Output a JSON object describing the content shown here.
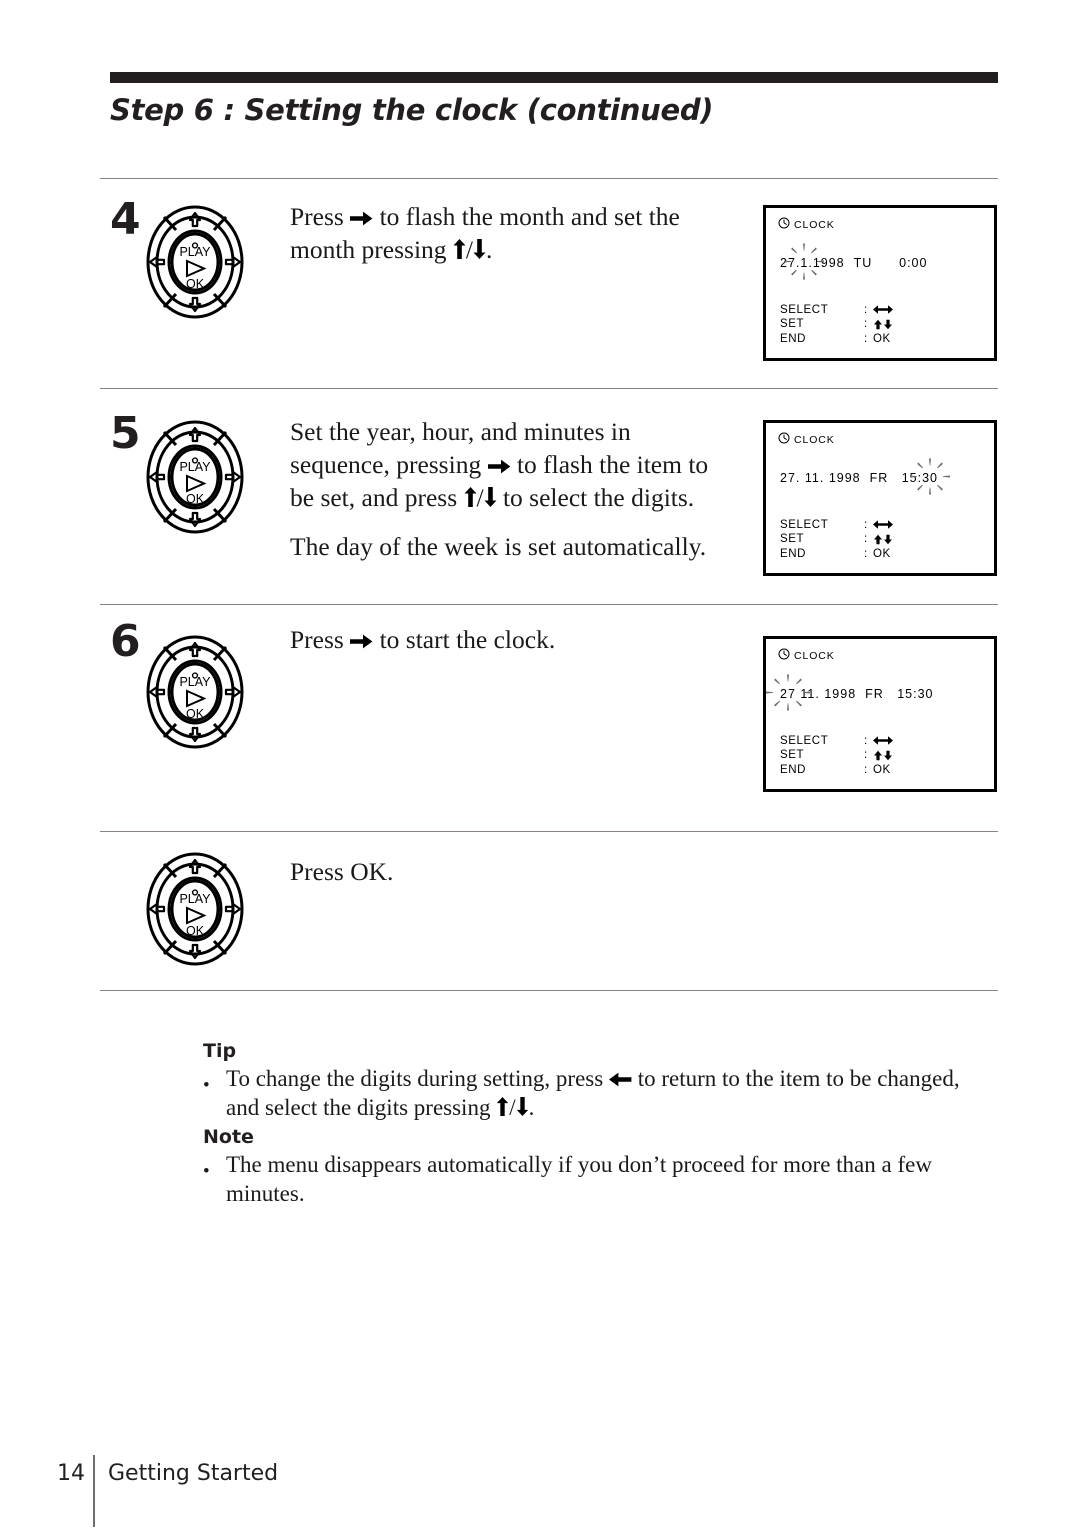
{
  "page": {
    "title": "Step 6 : Setting the clock (continued)",
    "footer_page_number": "14",
    "footer_section": "Getting Started"
  },
  "steps": [
    {
      "number": "4",
      "text_parts": [
        "Press ",
        "right-arrow",
        " to flash the month and set the month pressing ",
        "up-arrow",
        "/",
        "down-arrow",
        "."
      ],
      "text_plain": "Press ➡ to flash the month and set the month pressing ⬆/⬇.",
      "text_sub": "",
      "dpad": {
        "center_top": "PLAY",
        "center_bottom": "OK"
      },
      "osd": {
        "title": "CLOCK",
        "icon": "clock-icon",
        "day": "27",
        "sep1": ".",
        "month": "1",
        "sep2": ".",
        "year": "1998",
        "weekday": "TU",
        "hour": "0",
        "time_colon": ":",
        "minute": "00",
        "flashing_field": "month",
        "keys": [
          {
            "label": "SELECT",
            "colon": ":",
            "value": "left-right-arrows"
          },
          {
            "label": "SET",
            "colon": ":",
            "value": "up-down-arrows"
          },
          {
            "label": "END",
            "colon": ":",
            "value": "OK"
          }
        ]
      }
    },
    {
      "number": "5",
      "text_plain": "Set the year, hour, and minutes in sequence, pressing ➡ to flash the item to be set, and press ⬆/⬇ to select the digits.",
      "text_sub": "The day of the week is set automatically.",
      "dpad": {
        "center_top": "PLAY",
        "center_bottom": "OK"
      },
      "osd": {
        "title": "CLOCK",
        "icon": "clock-icon",
        "day": "27",
        "sep1": ".",
        "month": "11",
        "sep2": ".",
        "year": "1998",
        "weekday": "FR",
        "hour": "15",
        "time_colon": ":",
        "minute": "30",
        "flashing_field": "minute",
        "keys": [
          {
            "label": "SELECT",
            "colon": ":",
            "value": "left-right-arrows"
          },
          {
            "label": "SET",
            "colon": ":",
            "value": "up-down-arrows"
          },
          {
            "label": "END",
            "colon": ":",
            "value": "OK"
          }
        ]
      }
    },
    {
      "number": "6",
      "text_plain": "Press ➡ to start the clock.",
      "text_sub": "",
      "dpad": {
        "center_top": "PLAY",
        "center_bottom": "OK"
      },
      "osd": {
        "title": "CLOCK",
        "icon": "clock-icon",
        "day": "27",
        "sep1": ".",
        "month": "11",
        "sep2": ".",
        "year": "1998",
        "weekday": "FR",
        "hour": "15",
        "time_colon": ":",
        "minute": "30",
        "flashing_field": "day",
        "keys": [
          {
            "label": "SELECT",
            "colon": ":",
            "value": "left-right-arrows"
          },
          {
            "label": "SET",
            "colon": ":",
            "value": "up-down-arrows"
          },
          {
            "label": "END",
            "colon": ":",
            "value": "OK"
          }
        ]
      }
    },
    {
      "number": "",
      "text_plain": "Press OK.",
      "text_sub": "",
      "dpad": {
        "center_top": "PLAY",
        "center_bottom": "OK"
      },
      "osd": null
    }
  ],
  "tip": {
    "heading": "Tip",
    "bullet": "•",
    "line1_a": "To change the digits during setting, press ",
    "line1_b": " to return to the item to be changed,",
    "line2_a": "and select the digits pressing ",
    "line2_b": "/",
    "line2_c": "."
  },
  "note": {
    "heading": "Note",
    "bullet": "•",
    "line1": "The menu disappears automatically if you don’t proceed for more than a few",
    "line2": "minutes."
  },
  "colors": {
    "ink": "#231f20",
    "divider": "#8a8288",
    "osd_border": "#000000",
    "footer_rule": "#6d6d6d"
  }
}
